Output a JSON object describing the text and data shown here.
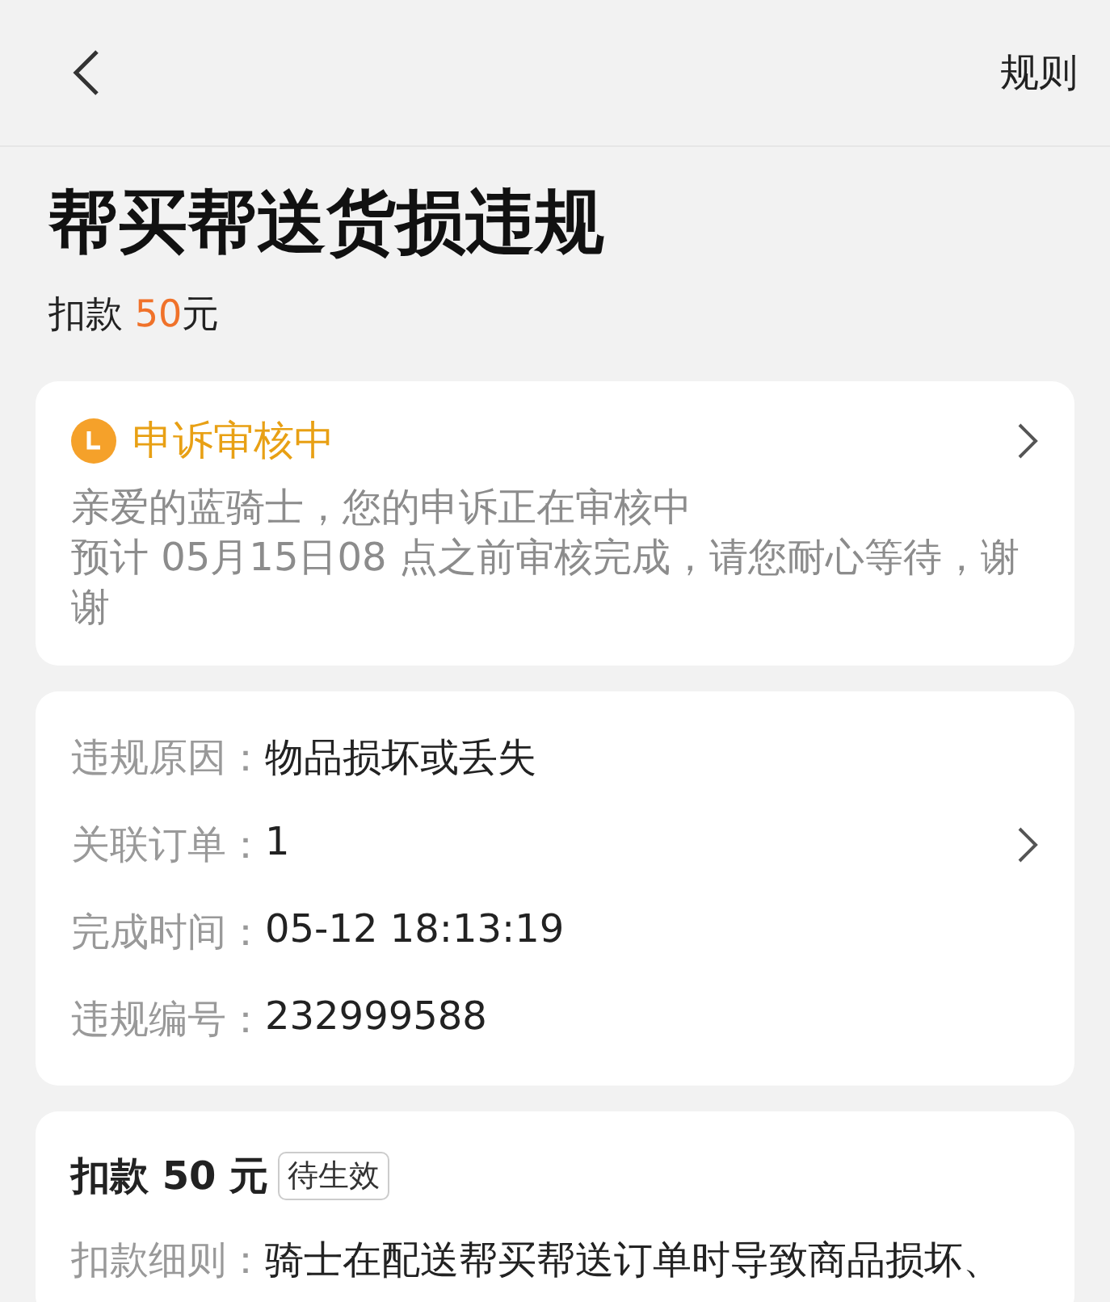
{
  "nav": {
    "action": "规则"
  },
  "header": {
    "title": "帮买帮送货损违规",
    "deduction_label": "扣款",
    "deduction_amount": "50",
    "deduction_unit": "元"
  },
  "status_card": {
    "status": "申诉审核中",
    "lines": [
      "亲爱的蓝骑士，您的申诉正在审核中",
      "预计 05月15日08 点之前审核完成，请您耐心等待，谢谢"
    ]
  },
  "details": [
    {
      "label": "违规原因：",
      "value": "物品损坏或丢失",
      "link": false
    },
    {
      "label": "关联订单：",
      "value": "1",
      "link": true
    },
    {
      "label": "完成时间：",
      "value": "05-12 18:13:19",
      "link": false
    },
    {
      "label": "违规编号：",
      "value": "232999588",
      "link": false
    }
  ],
  "penalty_card": {
    "title": "扣款 50 元",
    "tag": "待生效",
    "rule_label": "扣款细则：",
    "rule_text": "骑士在配送帮买帮送订单时导致商品损坏、"
  }
}
